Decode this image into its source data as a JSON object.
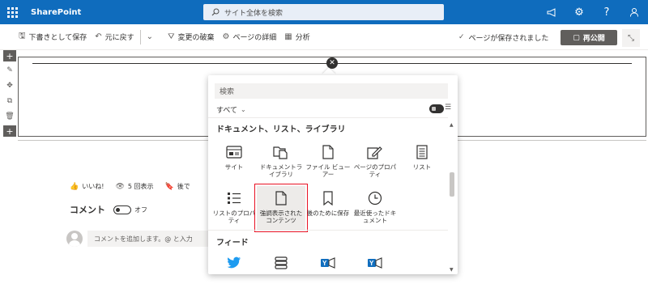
{
  "suite": {
    "brand": "SharePoint",
    "search_placeholder": "サイト全体を検索"
  },
  "commands": {
    "save_draft": "下書きとして保存",
    "undo": "元に戻す",
    "discard": "変更の破棄",
    "page_details": "ページの詳細",
    "analytics": "分析",
    "saved_status": "ページが保存されました",
    "republish": "再公開"
  },
  "social": {
    "like": "いいね!",
    "views": "5 回表示",
    "later": "後で"
  },
  "comments": {
    "title": "コメント",
    "toggle_state": "オフ",
    "placeholder": "コメントを追加します。@ と入力"
  },
  "picker": {
    "search_placeholder": "検索",
    "filter": "すべて",
    "category": "ドキュメント、リスト、ライブラリ",
    "tiles": [
      {
        "label": "サイト",
        "icon": "site-icon"
      },
      {
        "label": "ドキュメントライブラリ",
        "icon": "document-library-icon"
      },
      {
        "label": "ファイル ビューアー",
        "icon": "file-viewer-icon"
      },
      {
        "label": "ページのプロパティ",
        "icon": "page-properties-icon"
      },
      {
        "label": "リスト",
        "icon": "list-icon"
      },
      {
        "label": "リストのプロパティ",
        "icon": "list-properties-icon"
      },
      {
        "label": "強調表示されたコンテンツ",
        "icon": "highlighted-content-icon"
      },
      {
        "label": "後のために保存",
        "icon": "saved-for-later-icon"
      },
      {
        "label": "最近使ったドキュメント",
        "icon": "recent-documents-icon"
      }
    ],
    "feed_category": "フィード"
  },
  "colors": {
    "suite_bar": "#0f6cbd",
    "republish": "#605e5c",
    "highlight": "#e81123",
    "twitter": "#1d9bf0",
    "yammer": "#106ebe"
  }
}
